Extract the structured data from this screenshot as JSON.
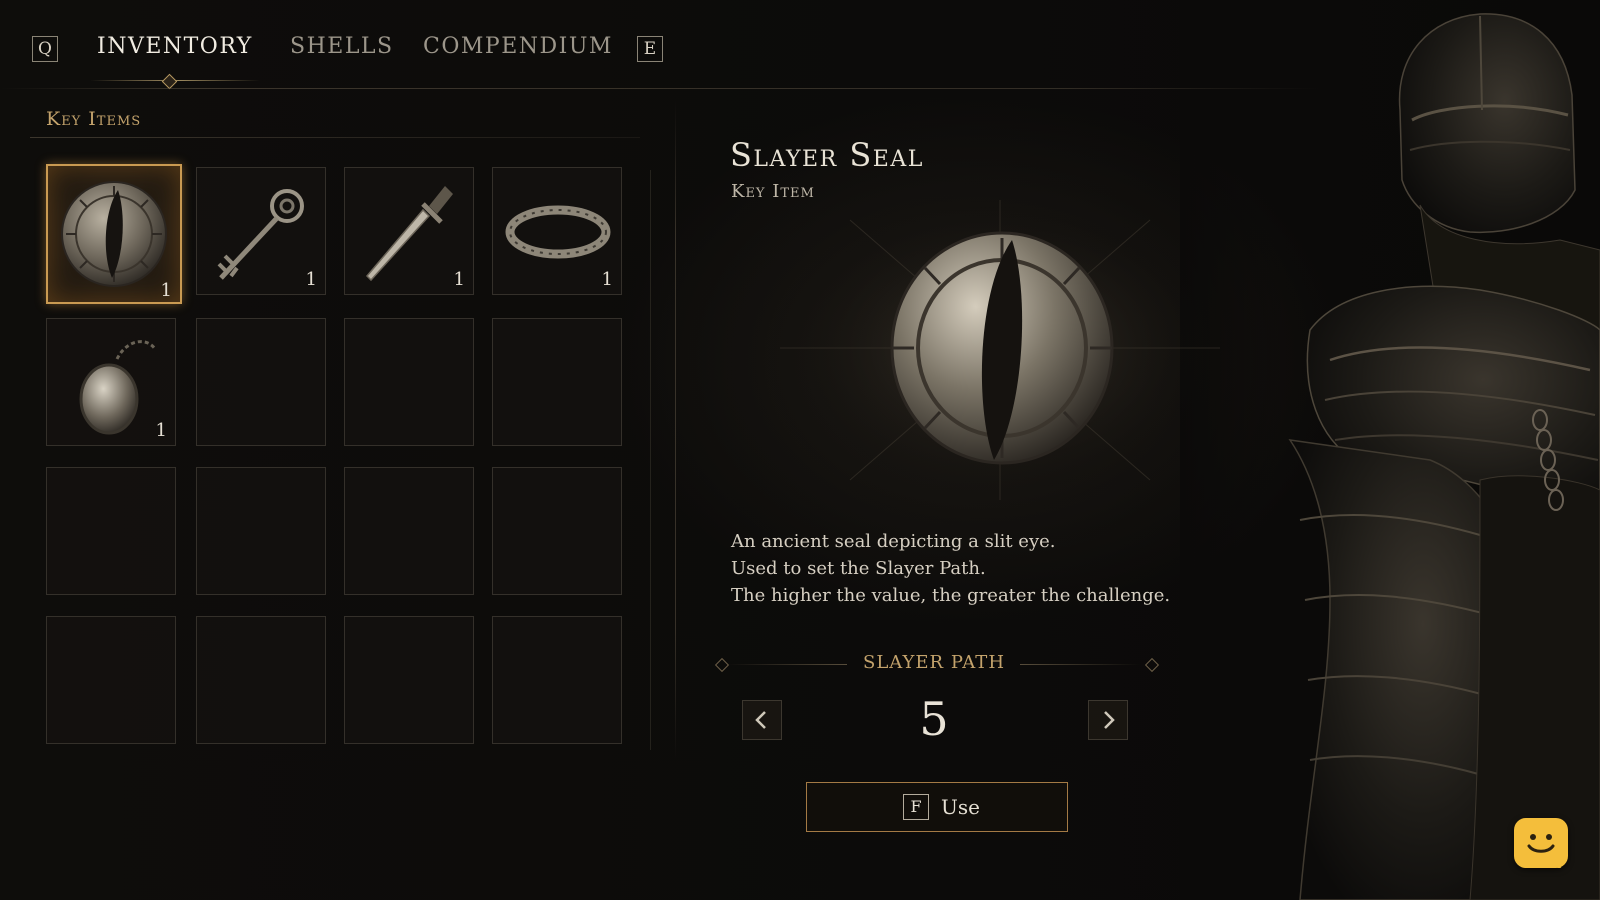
{
  "tabs": {
    "prev_key": "Q",
    "next_key": "E",
    "items": [
      {
        "label": "INVENTORY",
        "active": true
      },
      {
        "label": "SHELLS",
        "active": false
      },
      {
        "label": "COMPENDIUM",
        "active": false
      }
    ]
  },
  "inventory": {
    "section_title": "Key Items",
    "slots": [
      {
        "icon": "slayer-seal-icon",
        "quantity": "1",
        "selected": true
      },
      {
        "icon": "ornate-key-icon",
        "quantity": "1",
        "selected": false
      },
      {
        "icon": "dagger-icon",
        "quantity": "1",
        "selected": false
      },
      {
        "icon": "ring-icon",
        "quantity": "1",
        "selected": false
      },
      {
        "icon": "locket-icon",
        "quantity": "1",
        "selected": false
      },
      {
        "icon": null
      },
      {
        "icon": null
      },
      {
        "icon": null
      },
      {
        "icon": null
      },
      {
        "icon": null
      },
      {
        "icon": null
      },
      {
        "icon": null
      },
      {
        "icon": null
      },
      {
        "icon": null
      },
      {
        "icon": null
      },
      {
        "icon": null
      }
    ]
  },
  "detail": {
    "name": "Slayer Seal",
    "type": "Key Item",
    "icon": "slayer-seal-icon",
    "description": [
      "An ancient seal depicting a slit eye.",
      "Used to set the Slayer Path.",
      "The higher the value, the greater the challenge."
    ],
    "path_label": "SLAYER PATH",
    "path_value": "5",
    "use_key": "F",
    "use_label": "Use"
  },
  "colors": {
    "accent_gold": "#c4a36c",
    "selected_border": "#c99a52",
    "chat_button": "#f4be3b"
  }
}
